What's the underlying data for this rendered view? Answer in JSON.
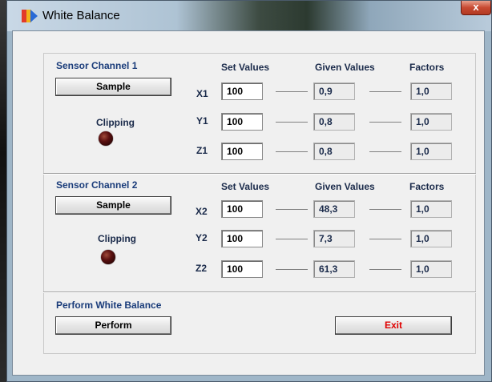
{
  "window": {
    "title": "White Balance",
    "close_glyph": "x"
  },
  "headers": {
    "set_values": "Set Values",
    "given_values": "Given Values",
    "factors": "Factors"
  },
  "channel1": {
    "title": "Sensor Channel 1",
    "sample_label": "Sample",
    "clipping_label": "Clipping",
    "rows": [
      {
        "axis": "X1",
        "set": "100",
        "given": "0,9",
        "factor": "1,0"
      },
      {
        "axis": "Y1",
        "set": "100",
        "given": "0,8",
        "factor": "1,0"
      },
      {
        "axis": "Z1",
        "set": "100",
        "given": "0,8",
        "factor": "1,0"
      }
    ]
  },
  "channel2": {
    "title": "Sensor Channel 2",
    "sample_label": "Sample",
    "clipping_label": "Clipping",
    "rows": [
      {
        "axis": "X2",
        "set": "100",
        "given": "48,3",
        "factor": "1,0"
      },
      {
        "axis": "Y2",
        "set": "100",
        "given": "7,3",
        "factor": "1,0"
      },
      {
        "axis": "Z2",
        "set": "100",
        "given": "61,3",
        "factor": "1,0"
      }
    ]
  },
  "perform": {
    "title": "Perform White Balance",
    "perform_label": "Perform",
    "exit_label": "Exit"
  },
  "colors": {
    "section_title": "#1a3c7a",
    "exit_text": "#e00000",
    "led_off": "#5a1010"
  }
}
